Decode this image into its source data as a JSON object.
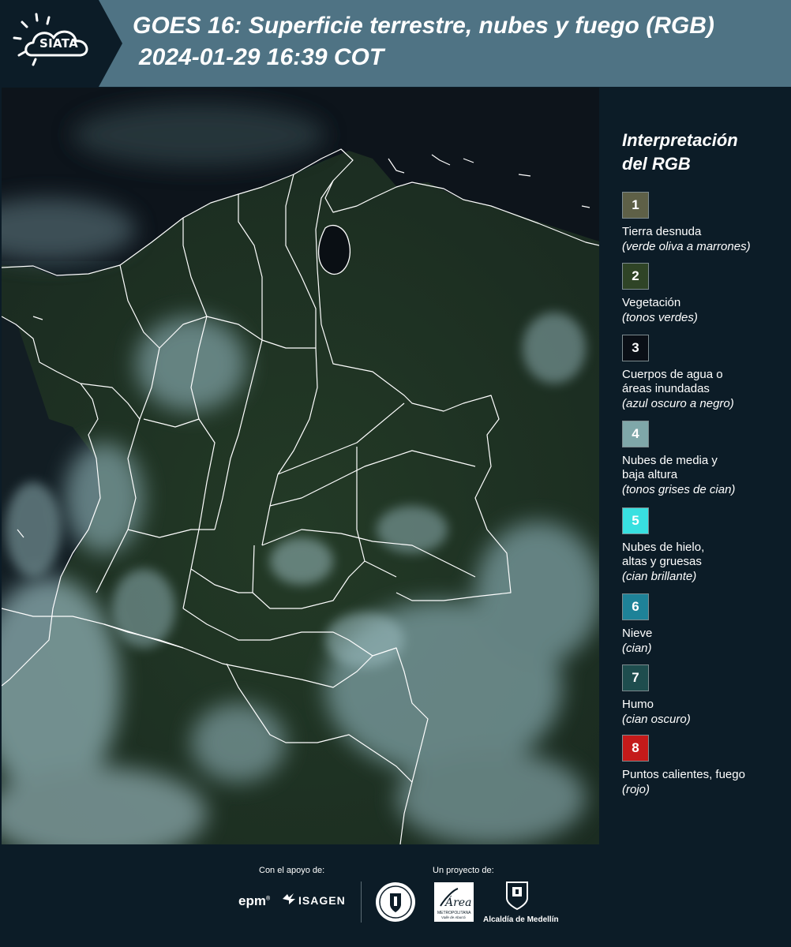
{
  "header": {
    "logo_text": "SIATA",
    "title": "GOES 16: Superficie terrestre, nubes y fuego (RGB)",
    "datetime": "2024-01-29 16:39 COT",
    "background_color": "#4f7384"
  },
  "legend": {
    "title_line1": "Interpretación",
    "title_line2": "del RGB",
    "items": [
      {
        "number": "1",
        "label_lines": [
          "Tierra desnuda"
        ],
        "desc": "(verde oliva a marrones)",
        "color": "#5e6047"
      },
      {
        "number": "2",
        "label_lines": [
          "Vegetación"
        ],
        "desc": "(tonos verdes)",
        "color": "#2f4426"
      },
      {
        "number": "3",
        "label_lines": [
          "Cuerpos de agua o",
          "áreas inundadas"
        ],
        "desc": "(azul oscuro a negro)",
        "color": "#0a0f16"
      },
      {
        "number": "4",
        "label_lines": [
          "Nubes de media y",
          "baja altura"
        ],
        "desc": "(tonos grises de cian)",
        "color": "#7fa7a9"
      },
      {
        "number": "5",
        "label_lines": [
          "Nubes de hielo,",
          "altas y gruesas"
        ],
        "desc": "(cian brillante)",
        "color": "#38e0e0"
      },
      {
        "number": "6",
        "label_lines": [
          "Nieve"
        ],
        "desc": "(cian)",
        "color": "#1e8298"
      },
      {
        "number": "7",
        "label_lines": [
          "Humo"
        ],
        "desc": "(cian oscuro)",
        "color": "#1e4d4e"
      },
      {
        "number": "8",
        "label_lines": [
          "Puntos calientes, fuego"
        ],
        "desc": "(rojo)",
        "color": "#c41a1a"
      }
    ]
  },
  "footer": {
    "support_label": "Con el apoyo de:",
    "project_label": "Un proyecto de:",
    "epm": "epm",
    "isagen": "ISAGEN",
    "area_name": "Área",
    "area_sub1": "METROPOLITANA",
    "area_sub2": "Valle de Aburrá",
    "alcaldia": "Alcaldía de Medellín"
  },
  "map": {
    "colors": {
      "ocean": "#0c1219",
      "land": "#223626",
      "cloud": "#8fb0b4",
      "border": "#ffffff"
    }
  }
}
